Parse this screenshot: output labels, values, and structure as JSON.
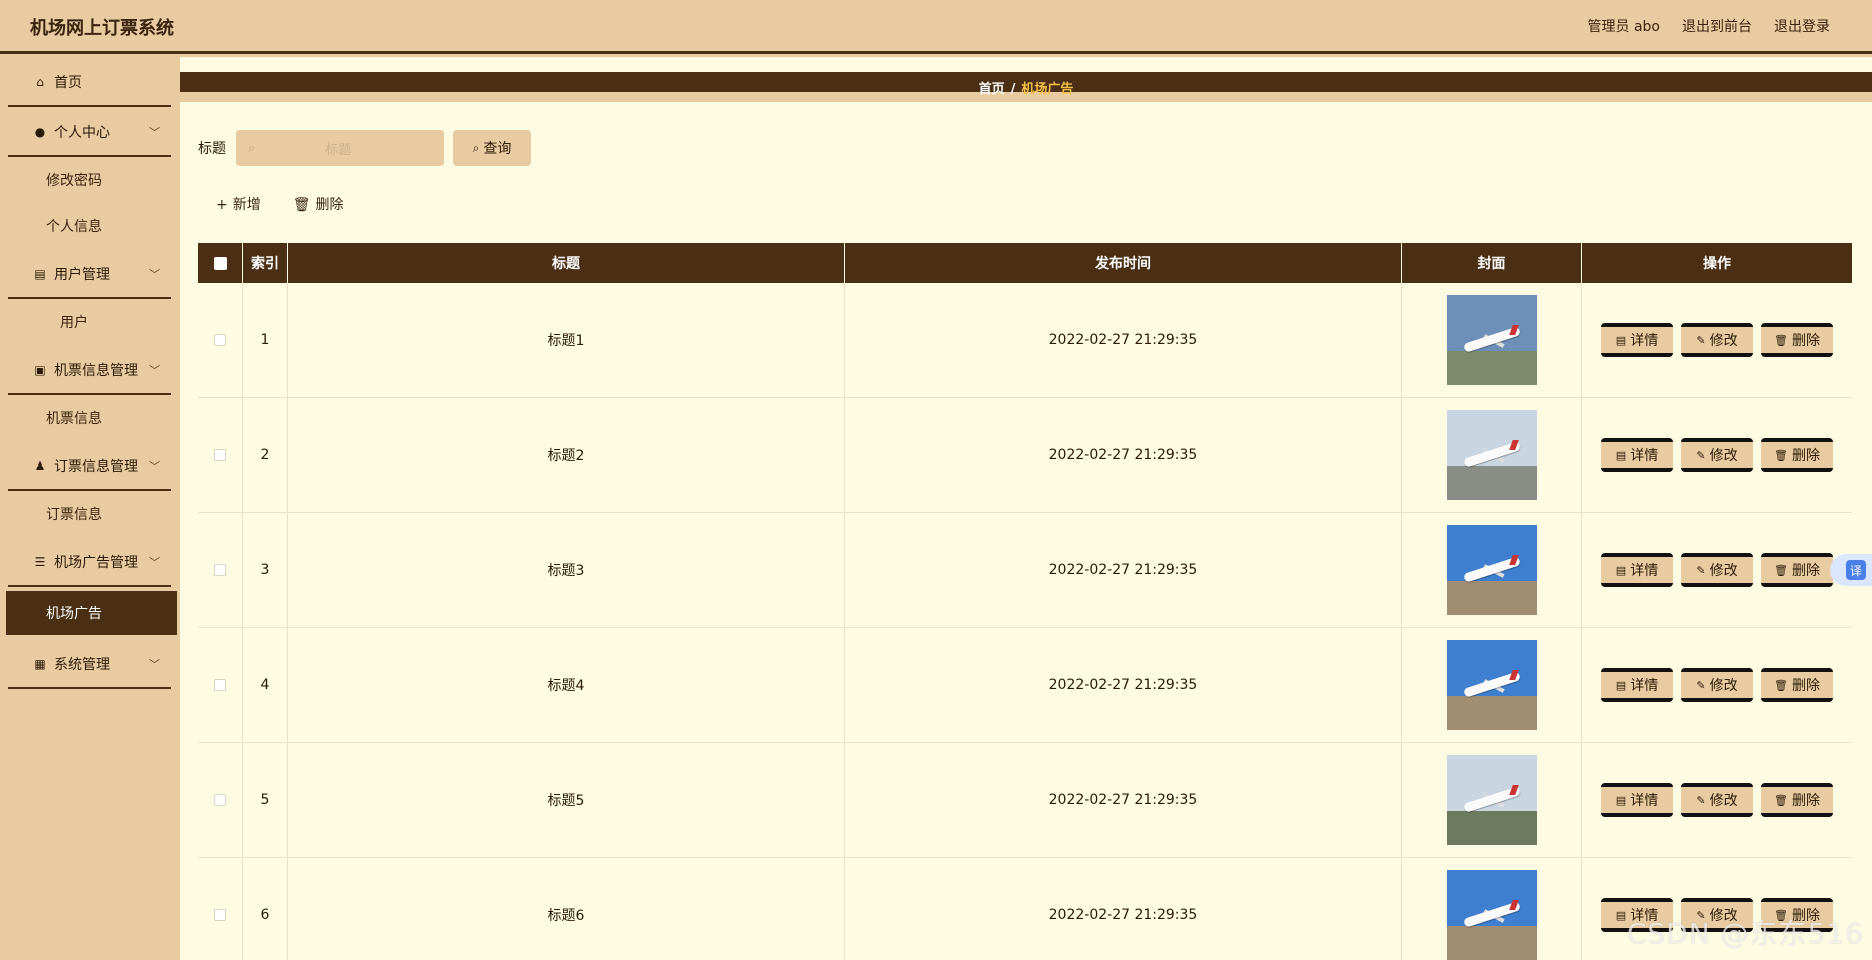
{
  "header": {
    "app_title": "机场网上订票系统",
    "user_label": "管理员 abo",
    "to_front_label": "退出到前台",
    "logout_label": "退出登录"
  },
  "sidebar": {
    "home": "首页",
    "groups": [
      {
        "label": "个人中心",
        "icon": "user-icon",
        "items": [
          "修改密码",
          "个人信息"
        ]
      },
      {
        "label": "用户管理",
        "icon": "document-icon",
        "items": [
          "用户"
        ]
      },
      {
        "label": "机票信息管理",
        "icon": "briefcase-icon",
        "items": [
          "机票信息"
        ]
      },
      {
        "label": "订票信息管理",
        "icon": "ticket-user-icon",
        "items": [
          "订票信息"
        ]
      },
      {
        "label": "机场广告管理",
        "icon": "sliders-icon",
        "items": [
          "机场广告"
        ]
      },
      {
        "label": "系统管理",
        "icon": "grid-icon",
        "items": []
      }
    ],
    "active_item": "机场广告"
  },
  "breadcrumb": {
    "home": "首页",
    "separator": "/",
    "current": "机场广告"
  },
  "search": {
    "label": "标题",
    "placeholder": "标题",
    "button_label": "查询"
  },
  "actions": {
    "add_label": "新增",
    "delete_label": "删除"
  },
  "table": {
    "columns": [
      "索引",
      "标题",
      "发布时间",
      "封面",
      "操作"
    ],
    "rows": [
      {
        "index": "1",
        "title": "标题1",
        "time": "2022-02-27 21:29:35"
      },
      {
        "index": "2",
        "title": "标题2",
        "time": "2022-02-27 21:29:35"
      },
      {
        "index": "3",
        "title": "标题3",
        "time": "2022-02-27 21:29:35"
      },
      {
        "index": "4",
        "title": "标题4",
        "time": "2022-02-27 21:29:35"
      },
      {
        "index": "5",
        "title": "标题5",
        "time": "2022-02-27 21:29:35"
      },
      {
        "index": "6",
        "title": "标题6",
        "time": "2022-02-27 21:29:35"
      }
    ],
    "row_actions": {
      "detail": "详情",
      "edit": "修改",
      "delete": "删除"
    }
  },
  "translate_badge": "译",
  "watermark": "CSDN @东东516",
  "colors": {
    "accent_dark": "#4a2f14",
    "sidebar_bg": "#e8cba0",
    "content_bg": "#fdfce2",
    "crumb_current": "#f4c04a"
  }
}
